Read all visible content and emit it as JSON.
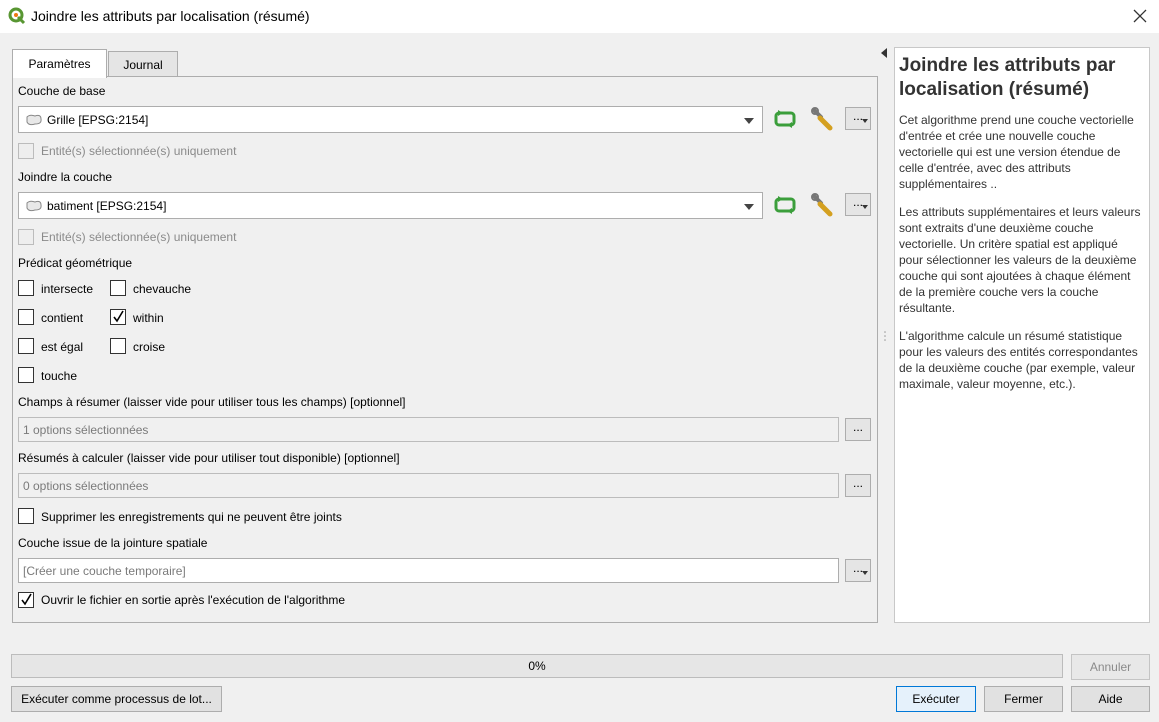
{
  "window": {
    "title": "Joindre les attributs par localisation (résumé)"
  },
  "tabs": [
    {
      "label": "Paramètres",
      "active": true
    },
    {
      "label": "Journal",
      "active": false
    }
  ],
  "params": {
    "base_layer": {
      "label": "Couche de base",
      "value": "Grille [EPSG:2154]",
      "selected_only_label": "Entité(s) sélectionnée(s) uniquement"
    },
    "join_layer": {
      "label": "Joindre la couche",
      "value": "batiment [EPSG:2154]",
      "selected_only_label": "Entité(s) sélectionnée(s) uniquement"
    },
    "predicate": {
      "label": "Prédicat géométrique",
      "options": [
        {
          "label": "intersecte",
          "checked": false
        },
        {
          "label": "chevauche",
          "checked": false
        },
        {
          "label": "contient",
          "checked": false
        },
        {
          "label": "within",
          "checked": true
        },
        {
          "label": "est égal",
          "checked": false
        },
        {
          "label": "croise",
          "checked": false
        },
        {
          "label": "touche",
          "checked": false
        }
      ]
    },
    "fields_summary": {
      "label": "Champs à résumer (laisser vide pour utiliser tous les champs) [optionnel]",
      "value": "1 options sélectionnées",
      "button": "..."
    },
    "summaries": {
      "label": "Résumés à calculer (laisser vide pour utiliser tout disponible) [optionnel]",
      "value": "0 options sélectionnées",
      "button": "..."
    },
    "discard": {
      "label": "Supprimer les enregistrements qui ne peuvent être joints",
      "checked": false
    },
    "output": {
      "label": "Couche issue de la jointure spatiale",
      "placeholder": "[Créer une couche temporaire]",
      "button": "..."
    },
    "open_after": {
      "label": "Ouvrir le fichier en sortie après l'exécution de l'algorithme",
      "checked": true
    },
    "more_button": "..."
  },
  "help": {
    "title": "Joindre les attributs par localisation (résumé)",
    "paragraphs": [
      "Cet algorithme prend une couche vectorielle d'entrée et crée une nouvelle couche vectorielle qui est une version étendue de celle d'entrée, avec des attributs supplémentaires ..",
      "Les attributs supplémentaires et leurs valeurs sont extraits d'une deuxième couche vectorielle. Un critère spatial est appliqué pour sélectionner les valeurs de la deuxième couche qui sont ajoutées à chaque élément de la première couche vers la couche résultante.",
      "L'algorithme calcule un résumé statistique pour les valeurs des entités correspondantes de la deuxième couche (par exemple, valeur maximale, valeur moyenne, etc.)."
    ]
  },
  "footer": {
    "progress_text": "0%",
    "progress_value": 0,
    "cancel": "Annuler",
    "batch": "Exécuter comme processus de lot...",
    "run": "Exécuter",
    "close": "Fermer",
    "help": "Aide"
  },
  "colors": {
    "qgis_green": "#589632",
    "qgis_yellow": "#ee7913",
    "refresh_green": "#3b9e3b"
  },
  "icons": [
    "qgis-logo-icon",
    "close-icon",
    "vector-layer-icon",
    "refresh-icon",
    "wrench-icon",
    "dropdown-arrow-icon",
    "checkmark-icon"
  ]
}
